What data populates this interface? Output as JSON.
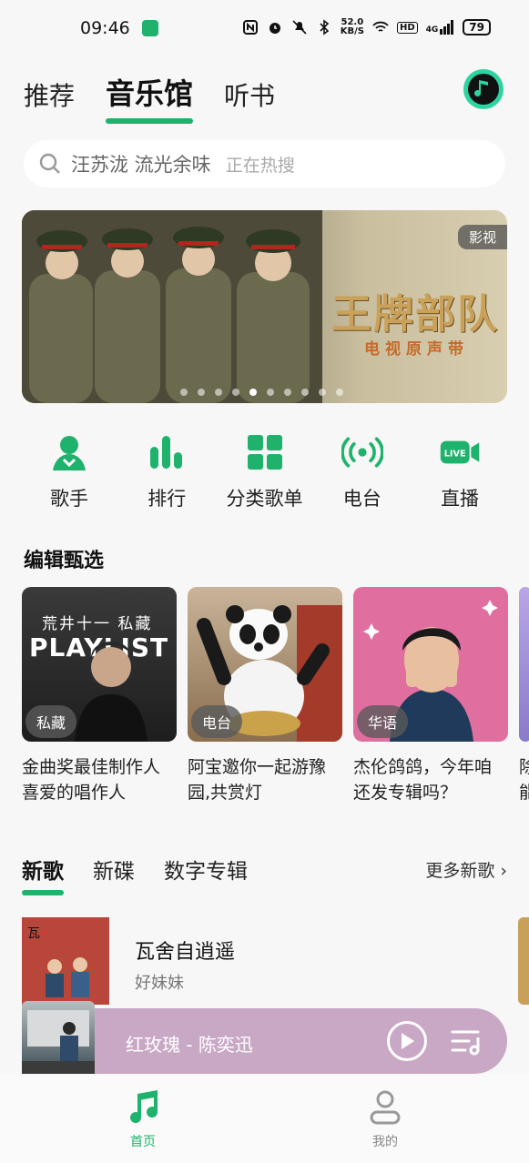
{
  "status_bar": {
    "time": "09:46",
    "net_speed_value": "52.0",
    "net_speed_unit": "KB/S",
    "hd": "HD",
    "signal": "4G",
    "battery": "79"
  },
  "top_tabs": [
    {
      "label": "推荐",
      "active": false
    },
    {
      "label": "音乐馆",
      "active": true
    },
    {
      "label": "听书",
      "active": false
    }
  ],
  "search": {
    "query": "汪苏泷 流光余味",
    "hint": "正在热搜"
  },
  "banner": {
    "title": "王牌部队",
    "subtitle": "电视原声带",
    "tag": "影视",
    "dot_count": 10,
    "active_dot": 4
  },
  "quick_nav": [
    {
      "label": "歌手",
      "icon": "singer-icon"
    },
    {
      "label": "排行",
      "icon": "chart-icon"
    },
    {
      "label": "分类歌单",
      "icon": "grid-icon"
    },
    {
      "label": "电台",
      "icon": "radio-icon"
    },
    {
      "label": "直播",
      "icon": "live-icon"
    }
  ],
  "editors_picks": {
    "title": "编辑甄选",
    "items": [
      {
        "badge": "私藏",
        "caption": "金曲奖最佳制作人喜爱的唱作人",
        "cover_text_top": "荒井十一 私藏",
        "cover_text_main": "PLAYLIST"
      },
      {
        "badge": "电台",
        "caption": "阿宝邀你一起游豫园,共赏灯"
      },
      {
        "badge": "华语",
        "caption": "杰伦鸽鸽，今年咱还发专辑吗？"
      }
    ],
    "partial_caption": "除\n能"
  },
  "new_songs": {
    "tabs": [
      {
        "label": "新歌",
        "active": true
      },
      {
        "label": "新碟",
        "active": false
      },
      {
        "label": "数字专辑",
        "active": false
      }
    ],
    "more": "更多新歌",
    "items": [
      {
        "name": "瓦舍自逍遥",
        "artist": "好妹妹"
      }
    ]
  },
  "player": {
    "now_playing": "红玫瑰 - 陈奕迅"
  },
  "bottom_nav": [
    {
      "label": "首页",
      "active": true
    },
    {
      "label": "我的",
      "active": false
    }
  ],
  "colors": {
    "accent": "#1fb26c",
    "player_bg": "#c9a8c6",
    "banner_title": "#c9a15a"
  }
}
